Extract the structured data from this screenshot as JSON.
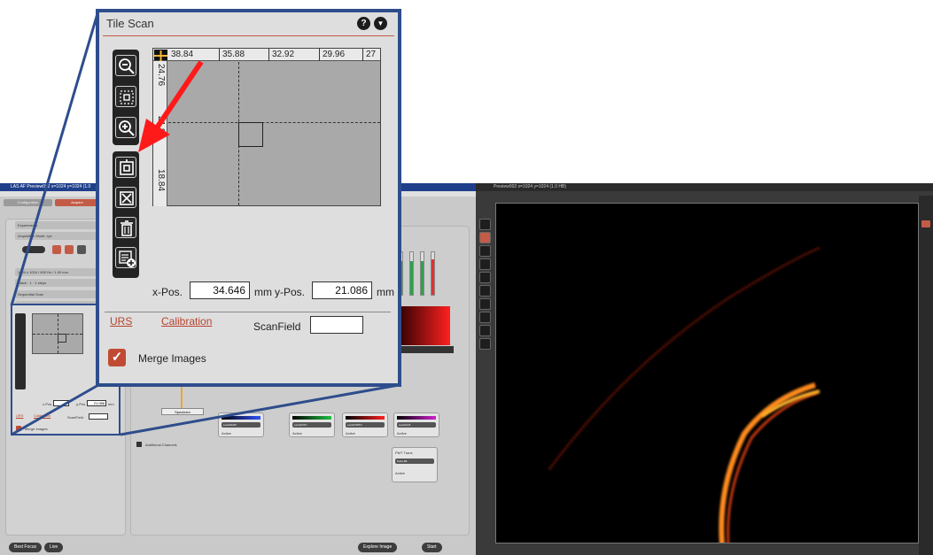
{
  "left_app": {
    "title": "LAS AF  Preview002  x=1024 y=1024 (1.0",
    "tabs": [
      "Configuration",
      "Acquire"
    ],
    "left_rows": [
      "Experiments",
      "Acquisition Mode: xyz",
      "1024 x 1024 / 600 Hz / 1.00 mm",
      "Stack · 1 · 1 steps",
      "Sequential Scan",
      "Tile Scan"
    ],
    "mini_tile_scan": {
      "x_value": "",
      "y_value": "21.086",
      "x_label": "x-Pos",
      "y_label": "y-Pos",
      "unit": "mm",
      "scanfield_label": "ScanField",
      "merge_label": "Merge Images",
      "urs": "URS",
      "calibration": "Calibration"
    },
    "channels": [
      {
        "label": "Leica/DAPI",
        "active": "Active",
        "color": "#3050ff"
      },
      {
        "label": "Leica/FITC",
        "active": "Active",
        "color": "#20c040"
      },
      {
        "label": "Leica/TRITC",
        "active": "Active",
        "color": "#ff2020"
      },
      {
        "label": "Leica/Cy5",
        "active": "Active",
        "color": "#d020d0"
      }
    ],
    "pmt_trans": {
      "label": "PMT Trans",
      "select": "Scan-BF",
      "active": "Active"
    },
    "specimen_label": "Specimen",
    "additional_channels": "Additional Channels",
    "bottom_buttons": {
      "best_focus": "Best Focus",
      "live": "Live",
      "explore": "Explore Image",
      "start": "Start"
    }
  },
  "image_window": {
    "title": "Preview002  x=1024 y=1024 (1.0 HB)"
  },
  "tile_scan": {
    "title": "Tile Scan",
    "help_icon": "?",
    "menu_icon": "▼",
    "ruler_top": [
      "38.84",
      "35.88",
      "32.92",
      "29.96",
      "27"
    ],
    "ruler_left": [
      "24.76",
      "21.8",
      "18.84"
    ],
    "x_label": "x-Pos.",
    "x_value": "34.646",
    "y_label": "y-Pos.",
    "y_value": "21.086",
    "unit": "mm",
    "urs_link": "URS",
    "calibration_link": "Calibration",
    "scanfield_label": "ScanField",
    "scanfield_value": "",
    "merge_label": "Merge Images",
    "merge_checked": true
  },
  "colors": {
    "accent": "#c45b47",
    "callout_border": "#2e4d8c",
    "arrow": "#ff1a1a"
  }
}
